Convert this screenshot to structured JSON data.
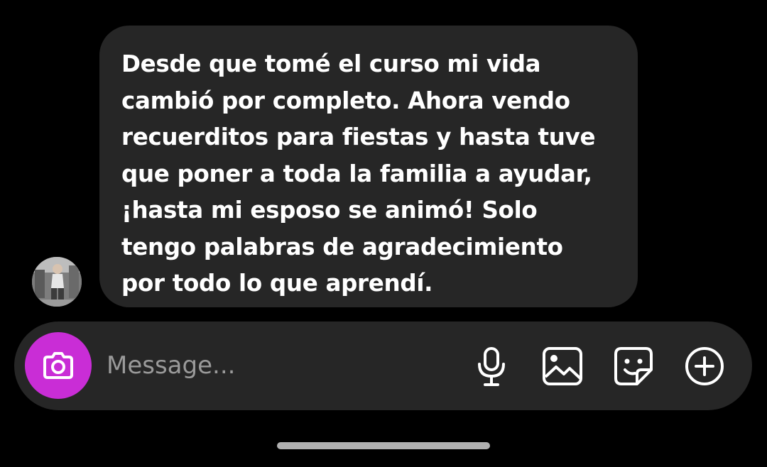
{
  "conversation": {
    "messages": [
      {
        "sender": "other",
        "text": "Desde que tomé el curso mi vida\ncambió por completo. Ahora vendo\nrecuerditos para fiestas y hasta tuve\nque poner a toda la familia a ayudar,\n¡hasta mi esposo se animó! Solo\ntengo palabras de agradecimiento\npor todo lo que aprendí."
      }
    ]
  },
  "composer": {
    "placeholder": "Message...",
    "value": "",
    "camera_button_color": "#c92dd6",
    "icons": [
      "camera-icon",
      "microphone-icon",
      "gallery-icon",
      "sticker-icon",
      "plus-circle-icon"
    ]
  },
  "theme": {
    "background": "#000000",
    "bubble": "#262626",
    "text": "#ffffff",
    "placeholder": "#9a9a9a"
  }
}
